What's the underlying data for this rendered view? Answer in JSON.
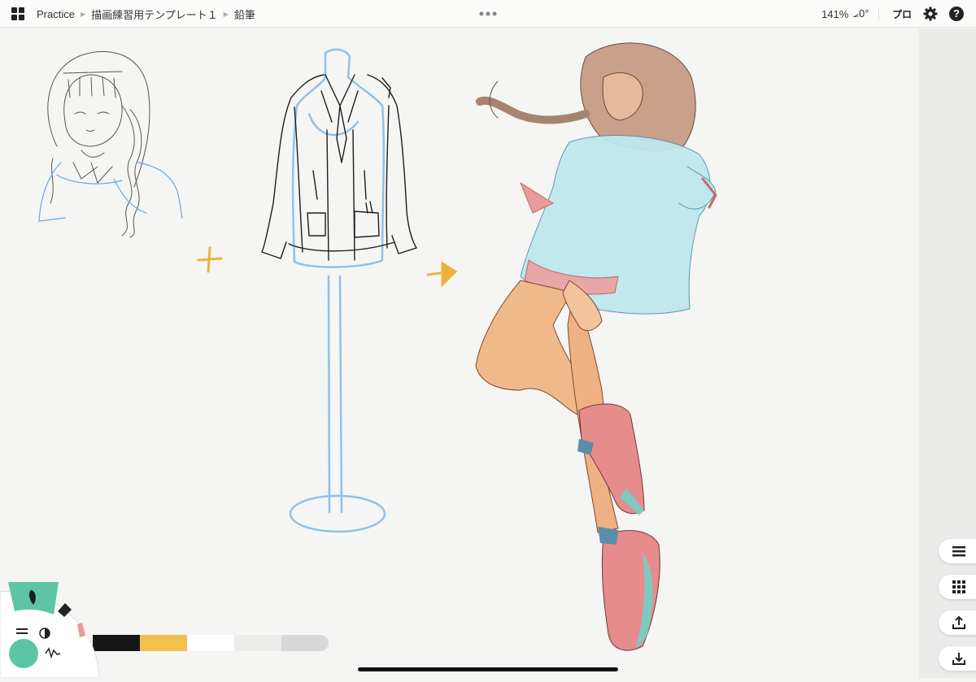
{
  "topbar": {
    "breadcrumb": [
      "Practice",
      "描画練習用テンプレート１",
      "鉛筆"
    ],
    "zoom": "141%",
    "rotation": "⦟0°",
    "plan_label": "プロ",
    "help_label": "?"
  },
  "icons": {
    "gallery": "grid-icon",
    "more": "more-dots-icon",
    "settings": "gear-icon",
    "help": "help-icon",
    "layers": "layers-icon",
    "templates": "dots-grid-icon",
    "export": "share-icon",
    "import": "import-icon",
    "pencil_tool": "pencil-icon",
    "marker_tool": "marker-icon",
    "eraser_tool": "eraser-icon",
    "size": "size-lines-icon",
    "opacity": "opacity-icon",
    "smoothing": "stroke-wave-icon"
  },
  "palette": {
    "current_color": "#5ec4a6",
    "swatches": [
      "#161616",
      "#f1c04d",
      "#ffffff",
      "#ececea",
      "#d6d8d9"
    ]
  }
}
